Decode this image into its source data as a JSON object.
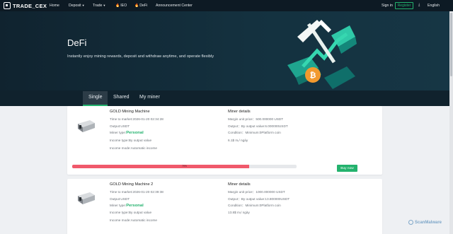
{
  "nav": {
    "logo_text": "TRADE_CEX",
    "home": "Home",
    "deposit": "Deposit",
    "trade": "Trade",
    "ieo": "IEO",
    "defi": "DeFi",
    "announcement": "Announcement Center",
    "signin": "Sign in",
    "register": "Register",
    "language": "English"
  },
  "hero": {
    "title": "DeFi",
    "subtitle": "Instantly enjoy mining rewards, deposit and withdraw anytime, and operate flexibly"
  },
  "tabs": [
    "Single",
    "Shared",
    "My miner"
  ],
  "cards": [
    {
      "name": "GOLD Mining Machine",
      "time": "Time to market:2026-01-20 02:34:28",
      "output": "Output:USDT",
      "miner_type_label": "Miner type:",
      "miner_type_value": "Personal",
      "income_type": "Income type:By output value",
      "income_mode": "Income mode:Automatic income",
      "details_title": "Miner details",
      "unit_price": "Margin unit price：500.000000 USDT",
      "output_value": "Output：By output value:6.000000USDT",
      "condition": "Condition：Minimum:0Platform coin",
      "rate": "6.1$ mᵣ/ ngày",
      "progress": 0.79,
      "progress_label": "79%",
      "buy_label": "Buy now"
    },
    {
      "name": "GOLD Mining Machine 2",
      "time": "Time to market:2026-01-20 02:39:38",
      "output": "Output:USDT",
      "miner_type_label": "Miner type:",
      "miner_type_value": "Personal",
      "income_type": "Income type:By output value",
      "income_mode": "Income mode:Automatic income",
      "details_title": "Miner details",
      "unit_price": "Margin unit price：1000.000000 USDT",
      "output_value": "Output：By output value:13.800000USDT",
      "condition": "Condition：Minimum:0Platform coin",
      "rate": "13.8$ mᵣ/ ngày"
    }
  ],
  "watermark": "ScanMalware",
  "colors": {
    "accent": "#23b26d",
    "progress": "#f0596b",
    "nav_bg": "#0d1a24"
  }
}
